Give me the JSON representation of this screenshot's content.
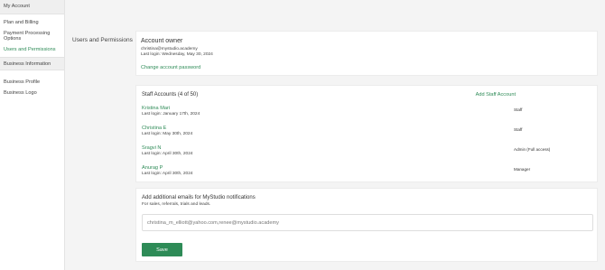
{
  "sidebar": {
    "header": "My Account",
    "account_items": [
      {
        "label": "Plan and Billing"
      },
      {
        "label": "Payment Processing Options"
      },
      {
        "label": "Users and Permissions"
      }
    ],
    "business_section": "Business Information",
    "business_items": [
      {
        "label": "Business Profile"
      },
      {
        "label": "Business Logo"
      }
    ]
  },
  "main": {
    "section_label": "Users and Permissions",
    "owner": {
      "title": "Account owner",
      "email": "christina@mystudio.academy",
      "last_login": "Last login: Wednesday, May 30, 2024",
      "change_password": "Change account password"
    },
    "staff": {
      "title": "Staff Accounts (4 of 50)",
      "add_label": "Add Staff Account",
      "members": [
        {
          "name": "Kristina Mari",
          "last_login": "Last login: January 17th, 2024",
          "role": "Staff"
        },
        {
          "name": "Christina E",
          "last_login": "Last login: May 30th, 2024",
          "role": "Staff"
        },
        {
          "name": "Sragvi N",
          "last_login": "Last login: April 30th, 2024",
          "role": "Admin (Full access)"
        },
        {
          "name": "Anurag P",
          "last_login": "Last login: April 30th, 2024",
          "role": "Manager"
        }
      ]
    },
    "notifications": {
      "title": "Add additional emails for MyStudio notifications",
      "subtitle": "For sales, referrals, trials and leads.",
      "emails_value": "christina_m_elliott@yahoo.com,renee@mystudio.academy",
      "save_label": "Save"
    }
  },
  "colors": {
    "accent": "#2e8b57",
    "background": "#f4f4f4"
  }
}
